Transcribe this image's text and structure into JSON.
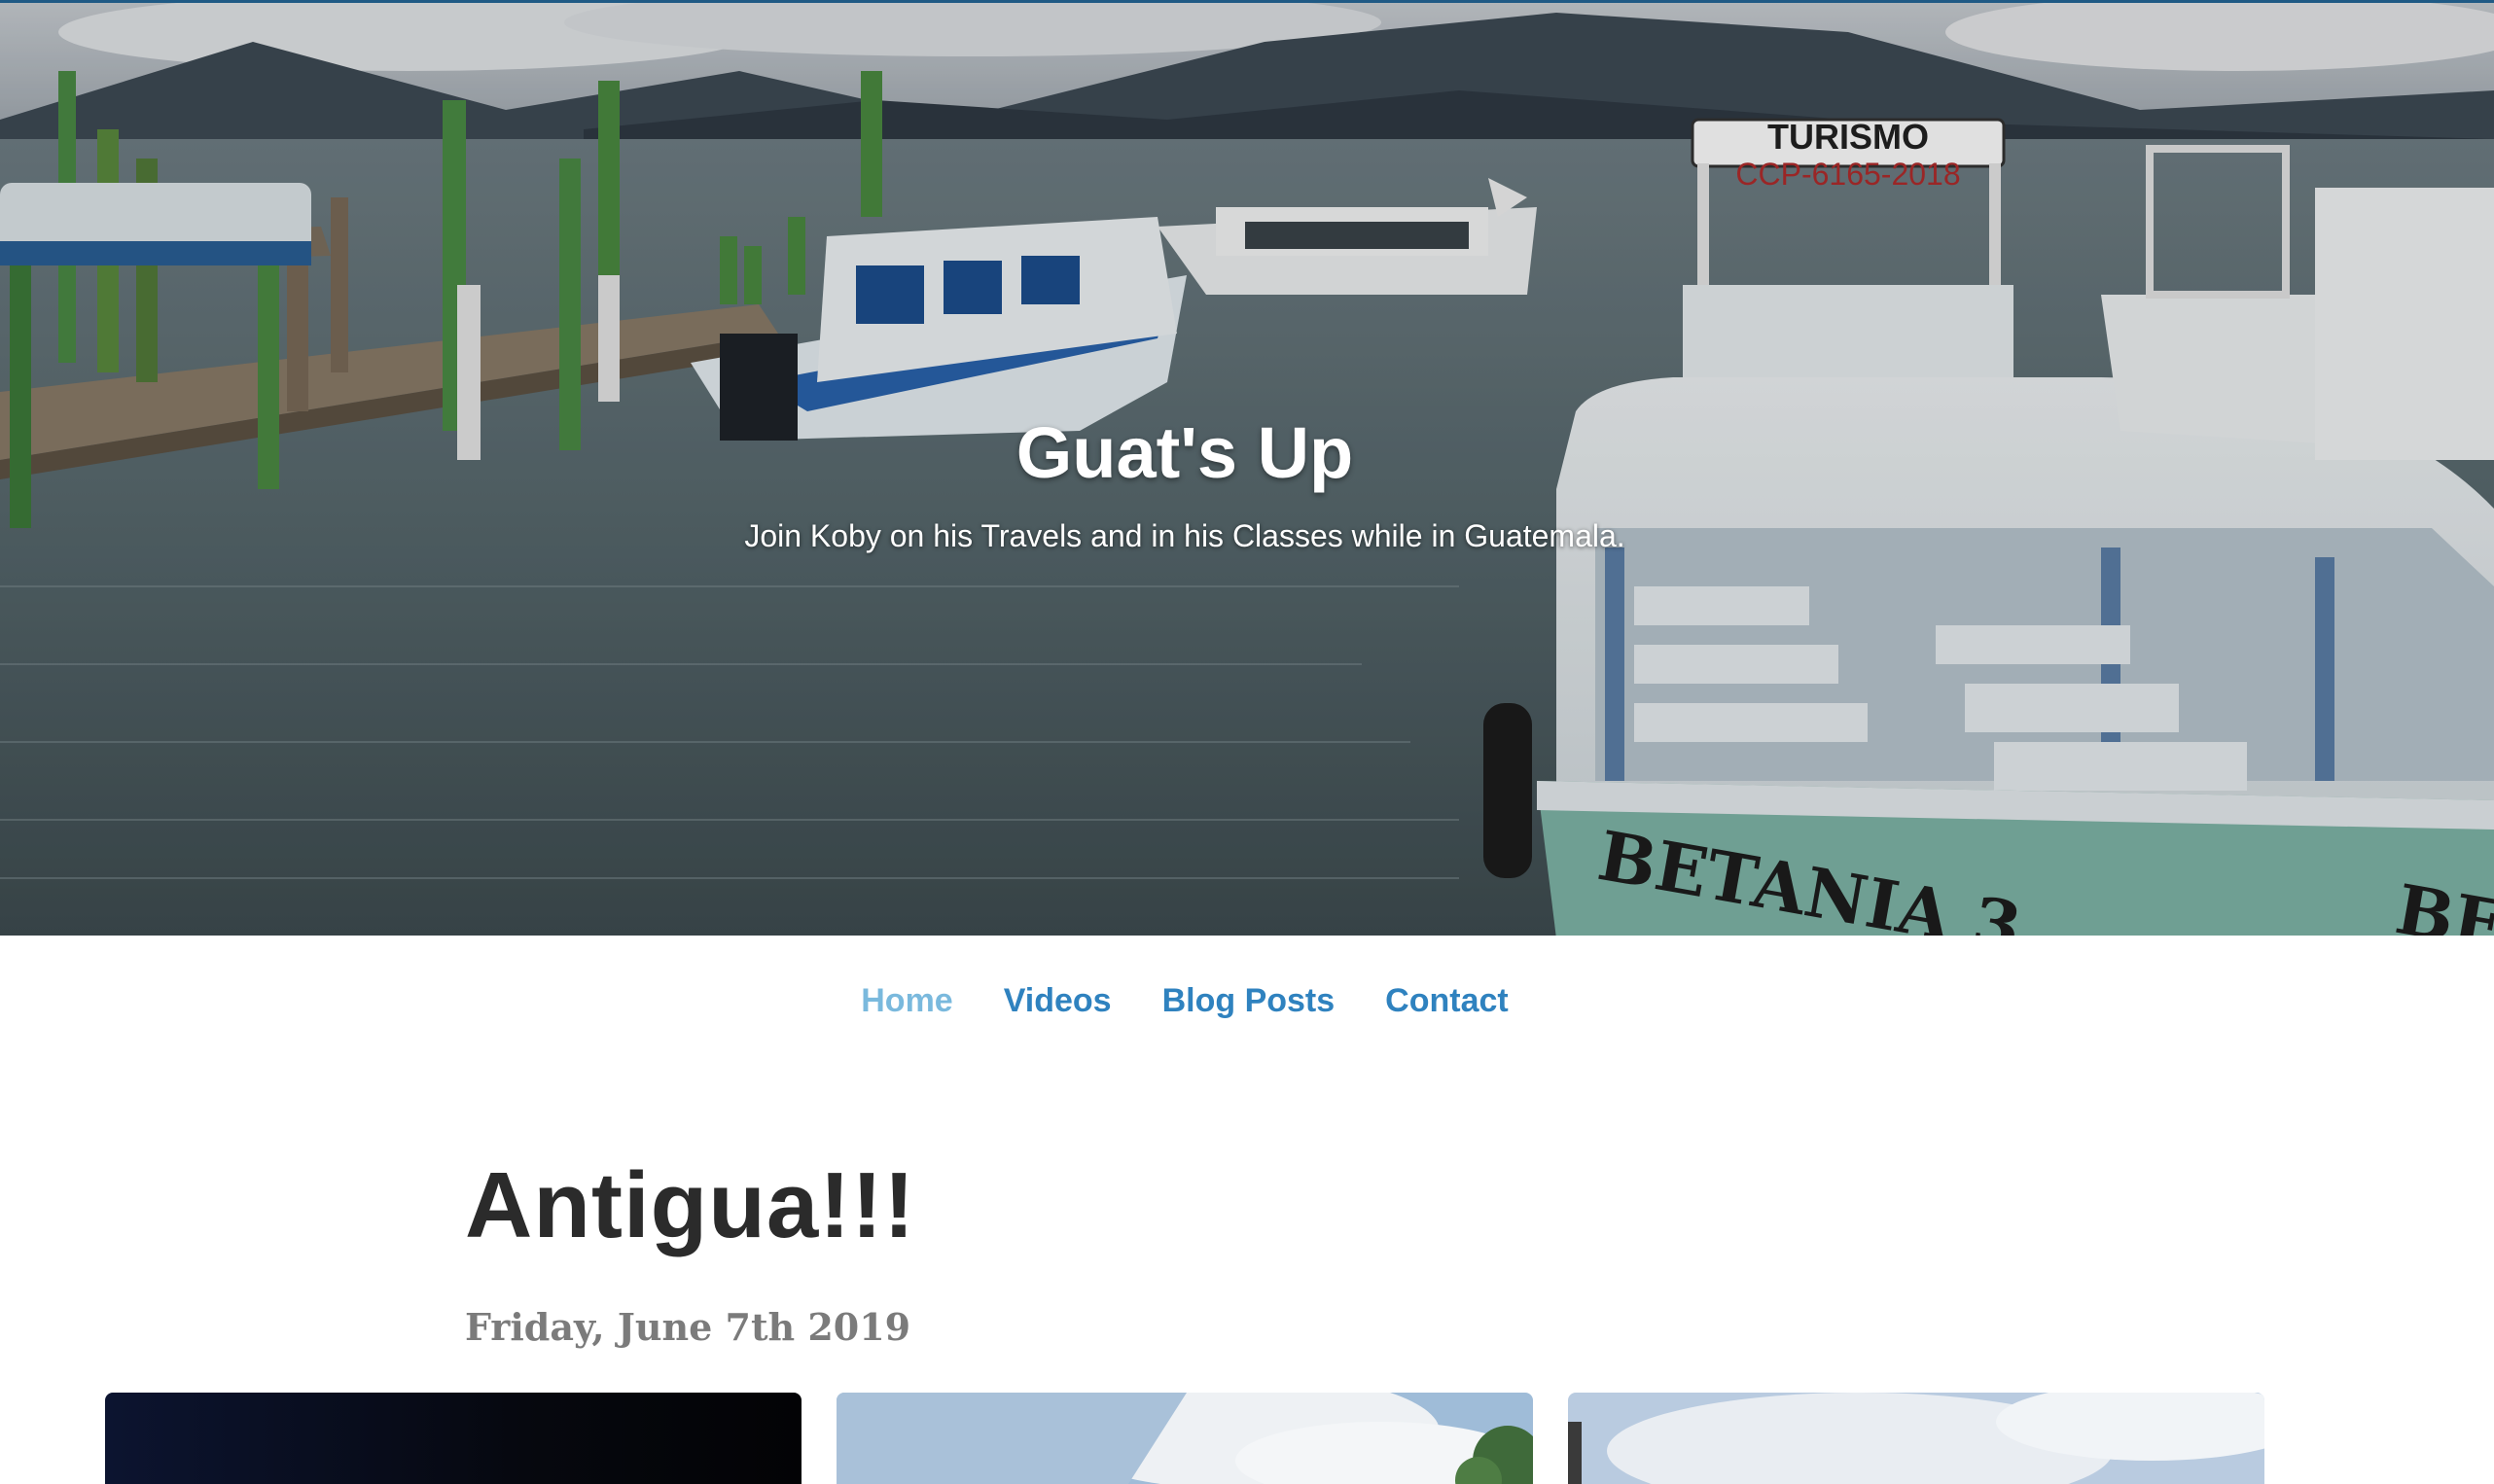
{
  "site": {
    "title": "Guat's Up",
    "subtitle": "Join Koby on his Travels and in his Classes while in Guatemala."
  },
  "hero": {
    "boat_sign_top": "TURISMO",
    "boat_sign_plate": "CCP-6165-2018",
    "boat_name": "BETANIA 3",
    "boat_name_partial": "BET"
  },
  "nav": {
    "items": [
      {
        "label": "Home",
        "active": true
      },
      {
        "label": "Videos",
        "active": false
      },
      {
        "label": "Blog Posts",
        "active": false
      },
      {
        "label": "Contact",
        "active": false
      }
    ]
  },
  "post": {
    "title": "Antigua!!!",
    "date": "Friday, June 7th 2019"
  },
  "colors": {
    "nav_link": "#2f82bf",
    "nav_active": "#7ab9dd",
    "post_title": "#2b2b2b",
    "post_date": "#7b7b7b"
  }
}
